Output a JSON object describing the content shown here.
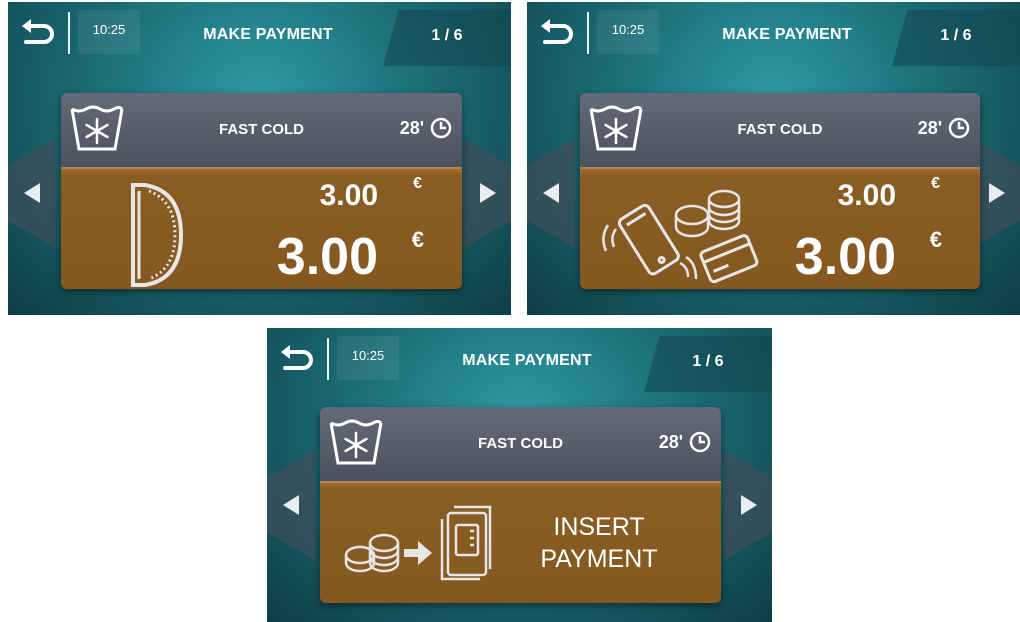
{
  "screens": [
    {
      "time": "10:25",
      "title": "MAKE PAYMENT",
      "page": "1 / 6",
      "program": "FAST COLD",
      "duration": "28'",
      "price_small": "3.00",
      "price_big": "3.00",
      "currency": "€",
      "payment_icon": "coin-acceptor-icon"
    },
    {
      "time": "10:25",
      "title": "MAKE PAYMENT",
      "page": "1 / 6",
      "program": "FAST COLD",
      "duration": "28'",
      "price_small": "3.00",
      "price_big": "3.00",
      "currency": "€",
      "payment_icon": "phone-coins-card-icon"
    },
    {
      "time": "10:25",
      "title": "MAKE PAYMENT",
      "page": "1 / 6",
      "program": "FAST COLD",
      "duration": "28'",
      "insert_line1": "INSERT",
      "insert_line2": "PAYMENT",
      "payment_icon": "coins-to-machine-icon"
    }
  ],
  "colors": {
    "background_teal": "#1c6f78",
    "program_bar": "#565c69",
    "payment_panel": "#8a5d25"
  }
}
